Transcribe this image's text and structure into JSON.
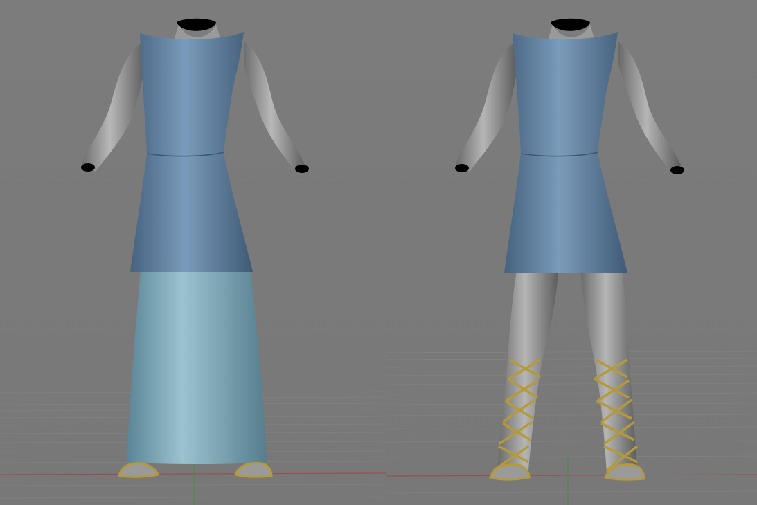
{
  "scene": {
    "background_color": "#7a7a7a",
    "grid_line_color": "#8c8c8c",
    "grid_axis_x_color": "#9a4a4a",
    "grid_axis_z_color": "#4a8a4a",
    "body_color": "#8a8a8a",
    "tunic_color": "#5b7a99",
    "skirt_color": "#6f9aaa",
    "sandal_color": "#b59a3a"
  },
  "viewports": [
    {
      "id": "left",
      "figure": "mannequin-with-long-skirt",
      "has_long_skirt": true,
      "has_tall_sandal_straps": false
    },
    {
      "id": "right",
      "figure": "mannequin-with-short-tunic",
      "has_long_skirt": false,
      "has_tall_sandal_straps": true
    }
  ]
}
